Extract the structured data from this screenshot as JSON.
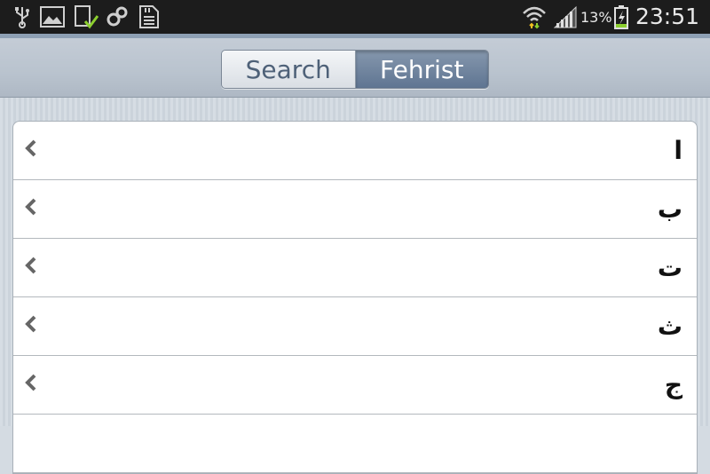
{
  "status_bar": {
    "icons": [
      "usb-icon",
      "gallery-icon",
      "download-done-icon",
      "sync-icon",
      "sd-card-icon",
      "wifi-icon",
      "signal-icon",
      "battery-charging-icon"
    ],
    "battery_percent": "13%",
    "time": "23:51"
  },
  "tabs": [
    {
      "label": "Search",
      "selected": false
    },
    {
      "label": "Fehrist",
      "selected": true
    }
  ],
  "colors": {
    "status_bar_bg": "#1c1c1c",
    "active_tab": "#6a7f9b",
    "battery_accent": "#8ccf2f"
  },
  "list": {
    "items": [
      {
        "letter": "ا"
      },
      {
        "letter": "ب"
      },
      {
        "letter": "ت"
      },
      {
        "letter": "ث"
      },
      {
        "letter": "ج"
      },
      {
        "letter": ""
      }
    ]
  }
}
